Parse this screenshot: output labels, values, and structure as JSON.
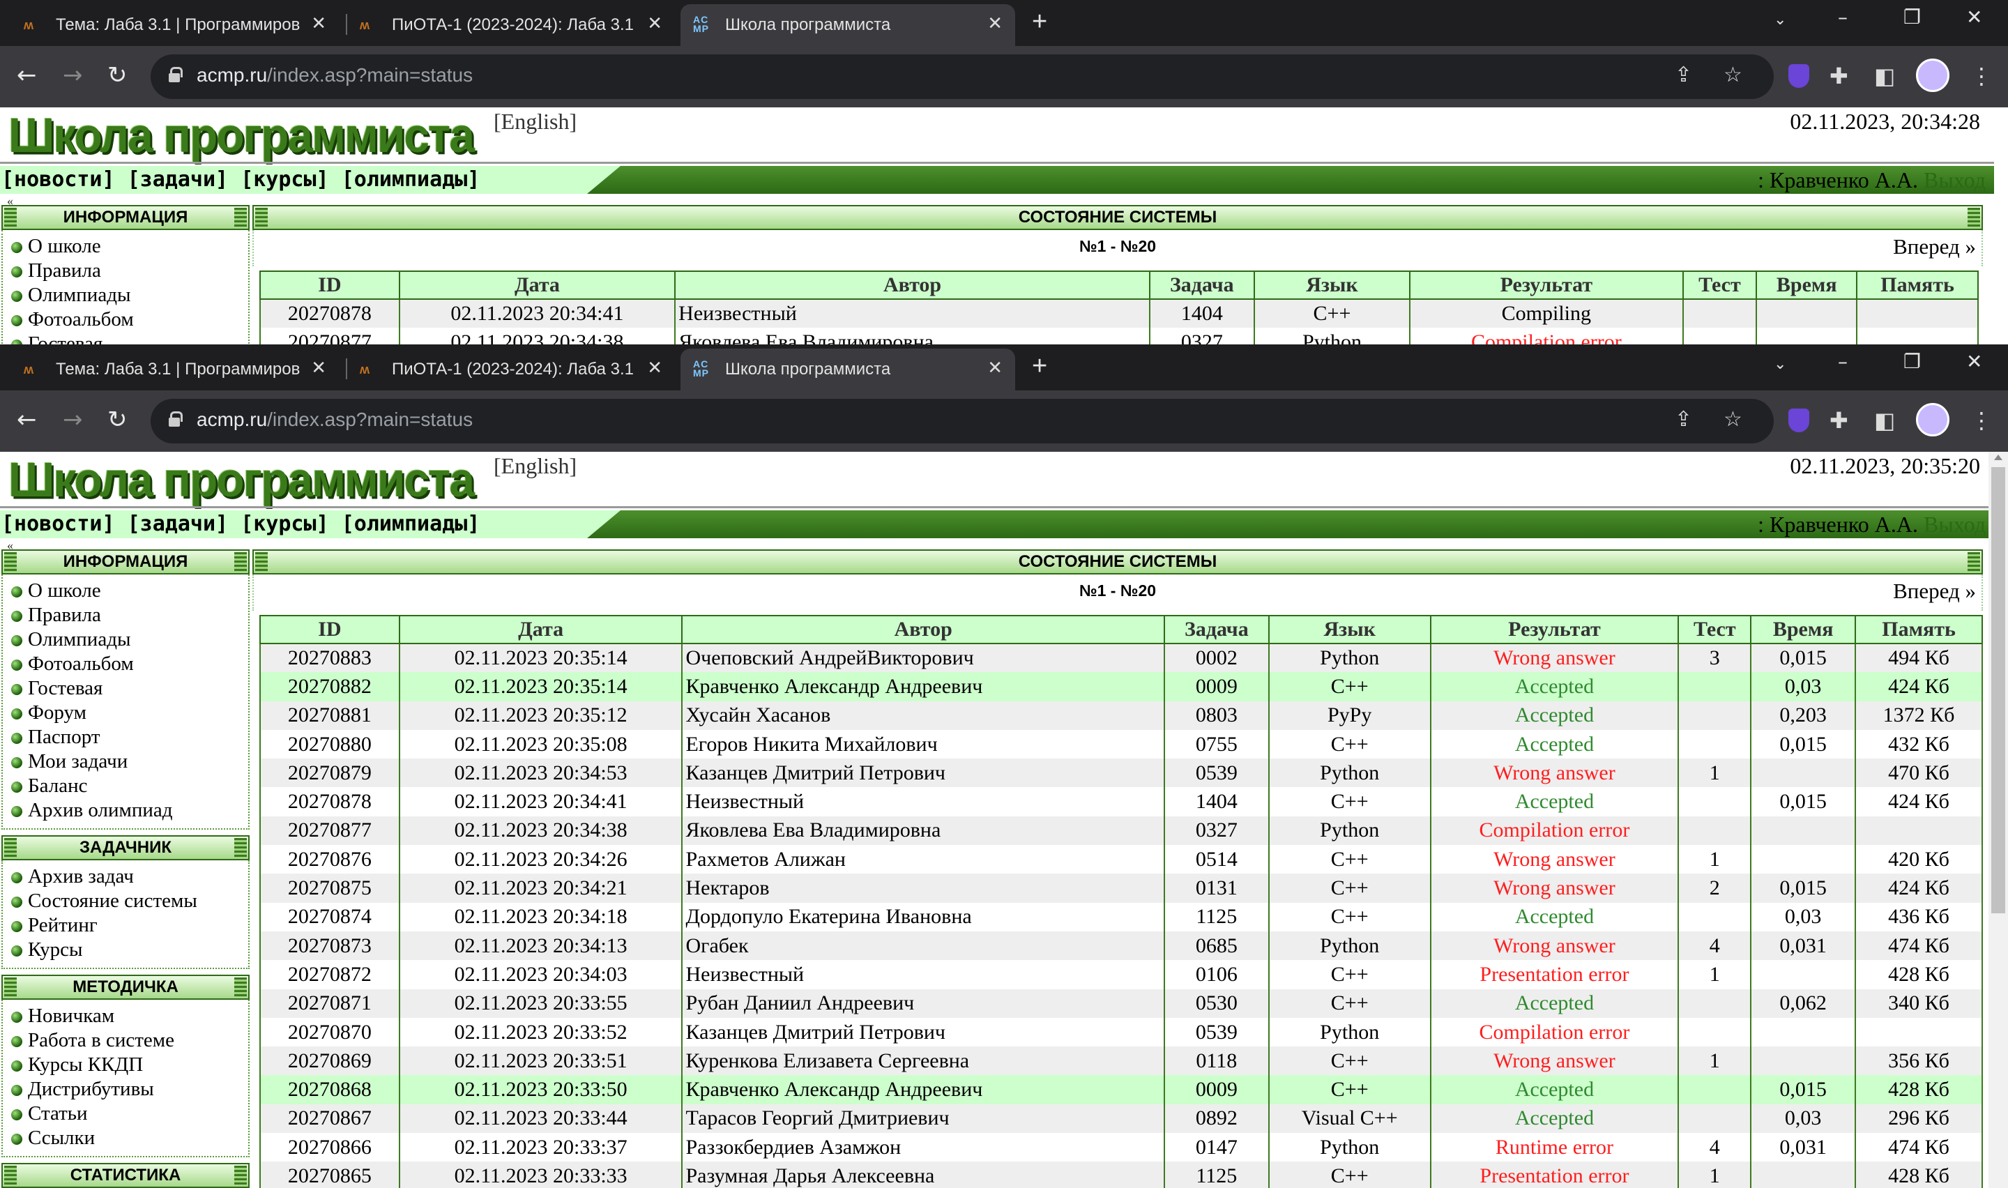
{
  "browser": {
    "tabs": [
      {
        "label": "Тема: Лаба 3.1 | Программиров",
        "icon": "moodle-icon"
      },
      {
        "label": "ПиОТА-1 (2023-2024): Лаба 3.1",
        "icon": "moodle-icon"
      },
      {
        "label": "Школа программиста",
        "icon": "acmp-icon"
      }
    ],
    "new_tab": "+",
    "url_host": "acmp.ru",
    "url_path": "/index.asp?main=status"
  },
  "site": {
    "logo": "Школа программиста",
    "english": "[English]",
    "menu": [
      "[новости]",
      "[задачи]",
      "[курсы]",
      "[олимпиады]"
    ],
    "user": ": Кравченко А.А.",
    "exit": "Выход",
    "nub": "«",
    "sections": [
      {
        "title": "ИНФОРМАЦИЯ",
        "items": [
          "О школе",
          "Правила",
          "Олимпиады",
          "Фотоальбом",
          "Гостевая",
          "Форум",
          "Паспорт",
          "Мои задачи",
          "Баланс",
          "Архив олимпиад"
        ]
      },
      {
        "title": "ЗАДАЧНИК",
        "items": [
          "Архив задач",
          "Состояние системы",
          "Рейтинг",
          "Курсы"
        ]
      },
      {
        "title": "МЕТОДИЧКА",
        "items": [
          "Новичкам",
          "Работа в системе",
          "Курсы ККДП",
          "Дистрибутивы",
          "Статьи",
          "Ссылки"
        ]
      },
      {
        "title": "СТАТИСТИКА",
        "items": []
      }
    ],
    "status_title": "СОСТОЯНИЕ СИСТЕМЫ",
    "pager": "№1 - №20",
    "next": "Вперед »",
    "columns": [
      "ID",
      "Дата",
      "Автор",
      "Задача",
      "Язык",
      "Результат",
      "Тест",
      "Время",
      "Память"
    ]
  },
  "window1": {
    "datetime": "02.11.2023, 20:34:28",
    "rows": [
      {
        "id": "20270878",
        "date": "02.11.2023 20:34:41",
        "author": "Неизвестный",
        "task": "1404",
        "lang": "C++",
        "result": "Compiling",
        "test": "",
        "time": "",
        "mem": "",
        "rc": "blk"
      },
      {
        "id": "20270877",
        "date": "02.11.2023 20:34:38",
        "author": "Яковлева Ева Владимировна",
        "task": "0327",
        "lang": "Python",
        "result": "Compilation error",
        "test": "",
        "time": "",
        "mem": "",
        "rc": "red"
      }
    ]
  },
  "window2": {
    "datetime": "02.11.2023, 20:35:20",
    "rows": [
      {
        "id": "20270883",
        "date": "02.11.2023 20:35:14",
        "author": "Очеповский АндрейВикторович",
        "task": "0002",
        "lang": "Python",
        "result": "Wrong answer",
        "test": "3",
        "time": "0,015",
        "mem": "494 Кб",
        "rc": "red"
      },
      {
        "id": "20270882",
        "date": "02.11.2023 20:35:14",
        "author": "Кравченко Александр Андреевич",
        "task": "0009",
        "lang": "C++",
        "result": "Accepted",
        "test": "",
        "time": "0,03",
        "mem": "424 Кб",
        "rc": "grn",
        "me": true
      },
      {
        "id": "20270881",
        "date": "02.11.2023 20:35:12",
        "author": "Хусайн Хасанов",
        "task": "0803",
        "lang": "PyPy",
        "result": "Accepted",
        "test": "",
        "time": "0,203",
        "mem": "1372 Кб",
        "rc": "grn"
      },
      {
        "id": "20270880",
        "date": "02.11.2023 20:35:08",
        "author": "Егоров Никита Михайлович",
        "task": "0755",
        "lang": "C++",
        "result": "Accepted",
        "test": "",
        "time": "0,015",
        "mem": "432 Кб",
        "rc": "grn"
      },
      {
        "id": "20270879",
        "date": "02.11.2023 20:34:53",
        "author": "Казанцев Дмитрий Петрович",
        "task": "0539",
        "lang": "Python",
        "result": "Wrong answer",
        "test": "1",
        "time": "",
        "mem": "470 Кб",
        "rc": "red"
      },
      {
        "id": "20270878",
        "date": "02.11.2023 20:34:41",
        "author": "Неизвестный",
        "task": "1404",
        "lang": "C++",
        "result": "Accepted",
        "test": "",
        "time": "0,015",
        "mem": "424 Кб",
        "rc": "grn"
      },
      {
        "id": "20270877",
        "date": "02.11.2023 20:34:38",
        "author": "Яковлева Ева Владимировна",
        "task": "0327",
        "lang": "Python",
        "result": "Compilation error",
        "test": "",
        "time": "",
        "mem": "",
        "rc": "red"
      },
      {
        "id": "20270876",
        "date": "02.11.2023 20:34:26",
        "author": "Рахметов Алижан",
        "task": "0514",
        "lang": "C++",
        "result": "Wrong answer",
        "test": "1",
        "time": "",
        "mem": "420 Кб",
        "rc": "red"
      },
      {
        "id": "20270875",
        "date": "02.11.2023 20:34:21",
        "author": "Нектаров",
        "task": "0131",
        "lang": "C++",
        "result": "Wrong answer",
        "test": "2",
        "time": "0,015",
        "mem": "424 Кб",
        "rc": "red"
      },
      {
        "id": "20270874",
        "date": "02.11.2023 20:34:18",
        "author": "Дордопуло Екатерина Ивановна",
        "task": "1125",
        "lang": "C++",
        "result": "Accepted",
        "test": "",
        "time": "0,03",
        "mem": "436 Кб",
        "rc": "grn"
      },
      {
        "id": "20270873",
        "date": "02.11.2023 20:34:13",
        "author": "Огабек",
        "task": "0685",
        "lang": "Python",
        "result": "Wrong answer",
        "test": "4",
        "time": "0,031",
        "mem": "474 Кб",
        "rc": "red"
      },
      {
        "id": "20270872",
        "date": "02.11.2023 20:34:03",
        "author": "Неизвестный",
        "task": "0106",
        "lang": "C++",
        "result": "Presentation error",
        "test": "1",
        "time": "",
        "mem": "428 Кб",
        "rc": "red"
      },
      {
        "id": "20270871",
        "date": "02.11.2023 20:33:55",
        "author": "Рубан Даниил Андреевич",
        "task": "0530",
        "lang": "C++",
        "result": "Accepted",
        "test": "",
        "time": "0,062",
        "mem": "340 Кб",
        "rc": "grn"
      },
      {
        "id": "20270870",
        "date": "02.11.2023 20:33:52",
        "author": "Казанцев Дмитрий Петрович",
        "task": "0539",
        "lang": "Python",
        "result": "Compilation error",
        "test": "",
        "time": "",
        "mem": "",
        "rc": "red"
      },
      {
        "id": "20270869",
        "date": "02.11.2023 20:33:51",
        "author": "Куренкова Елизавета Сергеевна",
        "task": "0118",
        "lang": "C++",
        "result": "Wrong answer",
        "test": "1",
        "time": "",
        "mem": "356 Кб",
        "rc": "red"
      },
      {
        "id": "20270868",
        "date": "02.11.2023 20:33:50",
        "author": "Кравченко Александр Андреевич",
        "task": "0009",
        "lang": "C++",
        "result": "Accepted",
        "test": "",
        "time": "0,015",
        "mem": "428 Кб",
        "rc": "grn",
        "me": true
      },
      {
        "id": "20270867",
        "date": "02.11.2023 20:33:44",
        "author": "Тарасов Георгий Дмитриевич",
        "task": "0892",
        "lang": "Visual C++",
        "result": "Accepted",
        "test": "",
        "time": "0,03",
        "mem": "296 Кб",
        "rc": "grn"
      },
      {
        "id": "20270866",
        "date": "02.11.2023 20:33:37",
        "author": "Раззокбердиев Азамжон",
        "task": "0147",
        "lang": "Python",
        "result": "Runtime error",
        "test": "4",
        "time": "0,031",
        "mem": "474 Кб",
        "rc": "red"
      },
      {
        "id": "20270865",
        "date": "02.11.2023 20:33:33",
        "author": "Разумная Дарья Алексеевна",
        "task": "1125",
        "lang": "C++",
        "result": "Presentation error",
        "test": "1",
        "time": "",
        "mem": "428 Кб",
        "rc": "red"
      }
    ]
  }
}
